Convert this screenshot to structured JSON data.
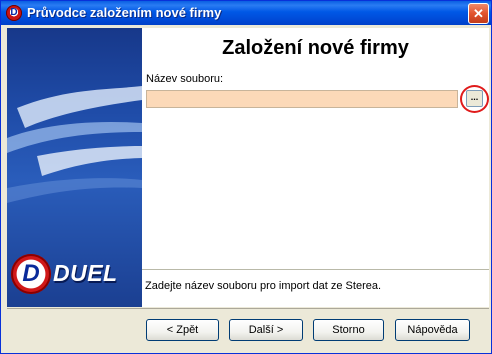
{
  "window": {
    "title": "Průvodce založením nové firmy",
    "app_icon_letter": "D"
  },
  "sidebar": {
    "logo_letter": "D",
    "logo_text": "DUEL"
  },
  "wizard": {
    "heading": "Založení nové firmy",
    "file_label": "Název souboru:",
    "file_value": "",
    "browse_label": "...",
    "hint": "Zadejte název souboru pro import dat ze Sterea."
  },
  "buttons": {
    "back": "< Zpět",
    "next": "Další >",
    "cancel": "Storno",
    "help": "Nápověda"
  },
  "colors": {
    "title_bar": "#0058e6",
    "sidebar": "#1f4ca8",
    "input_background": "#fcd9b8",
    "highlight_ring": "#e01b1b"
  }
}
